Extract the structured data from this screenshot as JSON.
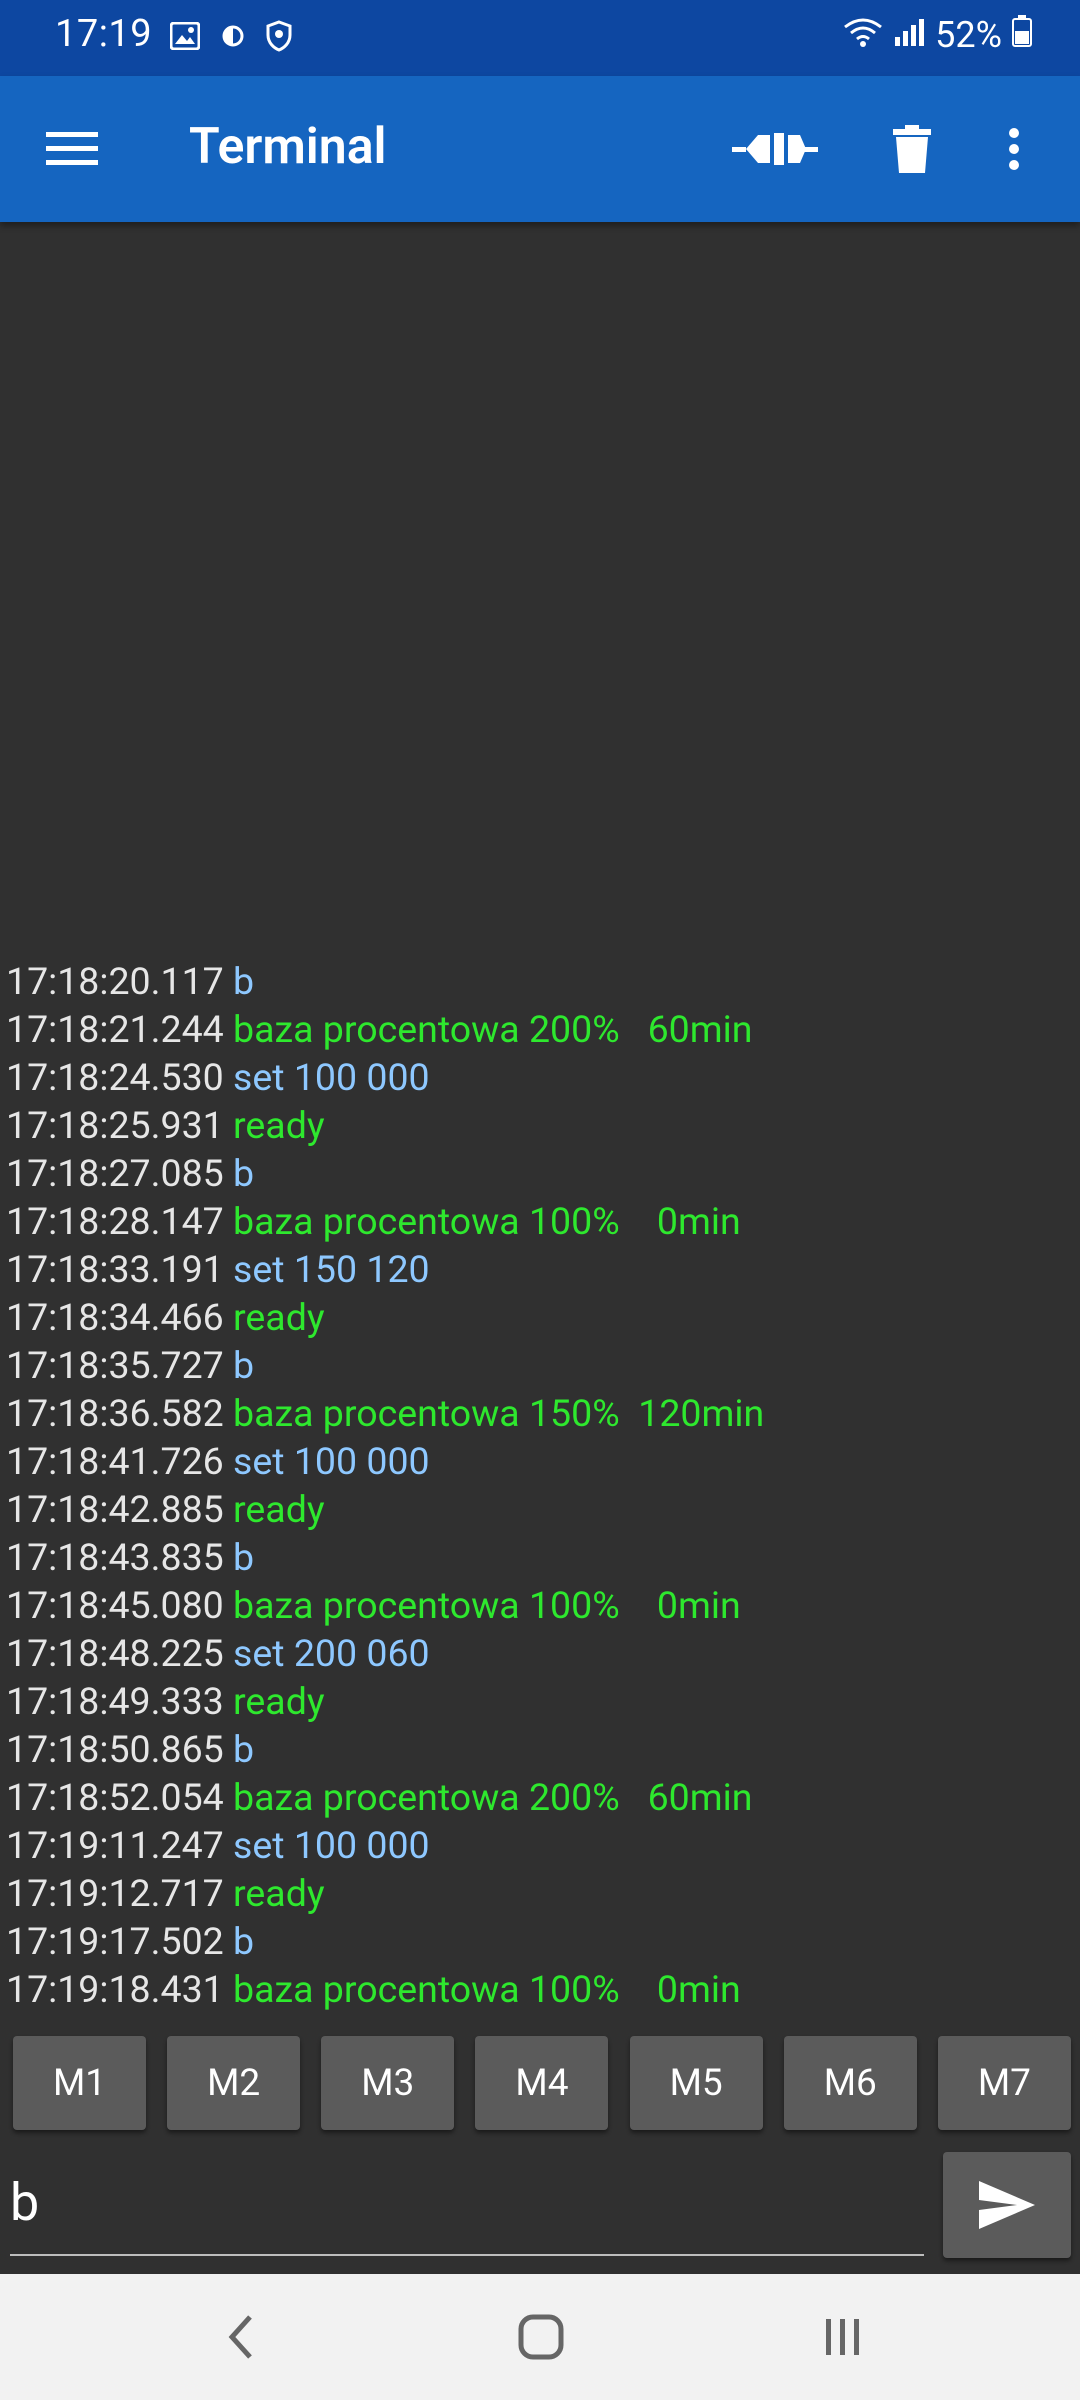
{
  "status_bar": {
    "time": "17:19",
    "battery": "52%",
    "icons": [
      "image-icon",
      "data-saver-icon",
      "shield-icon",
      "wifi-icon",
      "signal-icon",
      "battery-icon"
    ]
  },
  "app_bar": {
    "title": "Terminal",
    "actions": [
      "connect-icon",
      "trash-icon",
      "more-vert-icon"
    ]
  },
  "log": [
    {
      "time": "17:18:20.117",
      "text": "b",
      "kind": "sent"
    },
    {
      "time": "17:18:21.244",
      "text": "baza procentowa 200%   60min",
      "kind": "recv"
    },
    {
      "time": "17:18:24.530",
      "text": "set 100 000",
      "kind": "sent"
    },
    {
      "time": "17:18:25.931",
      "text": "ready",
      "kind": "recv"
    },
    {
      "time": "17:18:27.085",
      "text": "b",
      "kind": "sent"
    },
    {
      "time": "17:18:28.147",
      "text": "baza procentowa 100%    0min",
      "kind": "recv"
    },
    {
      "time": "17:18:33.191",
      "text": "set 150 120",
      "kind": "sent"
    },
    {
      "time": "17:18:34.466",
      "text": "ready",
      "kind": "recv"
    },
    {
      "time": "17:18:35.727",
      "text": "b",
      "kind": "sent"
    },
    {
      "time": "17:18:36.582",
      "text": "baza procentowa 150%  120min",
      "kind": "recv"
    },
    {
      "time": "17:18:41.726",
      "text": "set 100 000",
      "kind": "sent"
    },
    {
      "time": "17:18:42.885",
      "text": "ready",
      "kind": "recv"
    },
    {
      "time": "17:18:43.835",
      "text": "b",
      "kind": "sent"
    },
    {
      "time": "17:18:45.080",
      "text": "baza procentowa 100%    0min",
      "kind": "recv"
    },
    {
      "time": "17:18:48.225",
      "text": "set 200 060",
      "kind": "sent"
    },
    {
      "time": "17:18:49.333",
      "text": "ready",
      "kind": "recv"
    },
    {
      "time": "17:18:50.865",
      "text": "b",
      "kind": "sent"
    },
    {
      "time": "17:18:52.054",
      "text": "baza procentowa 200%   60min",
      "kind": "recv"
    },
    {
      "time": "17:19:11.247",
      "text": "set 100 000",
      "kind": "sent"
    },
    {
      "time": "17:19:12.717",
      "text": "ready",
      "kind": "recv"
    },
    {
      "time": "17:19:17.502",
      "text": "b",
      "kind": "sent"
    },
    {
      "time": "17:19:18.431",
      "text": "baza procentowa 100%    0min",
      "kind": "recv"
    }
  ],
  "macros": [
    "M1",
    "M2",
    "M3",
    "M4",
    "M5",
    "M6",
    "M7"
  ],
  "input": {
    "value": "b"
  },
  "send_button": {
    "icon": "send-icon"
  },
  "nav_bar": {
    "buttons": [
      "back-icon",
      "home-icon",
      "recent-apps-icon"
    ]
  },
  "colors": {
    "status_bar": "#0d47a1",
    "app_bar": "#1565c0",
    "background": "#303030",
    "timestamp": "#e6e6e6",
    "sent_text": "#8ec8ff",
    "received_text": "#2ee82e",
    "button": "#5b5b5b"
  }
}
